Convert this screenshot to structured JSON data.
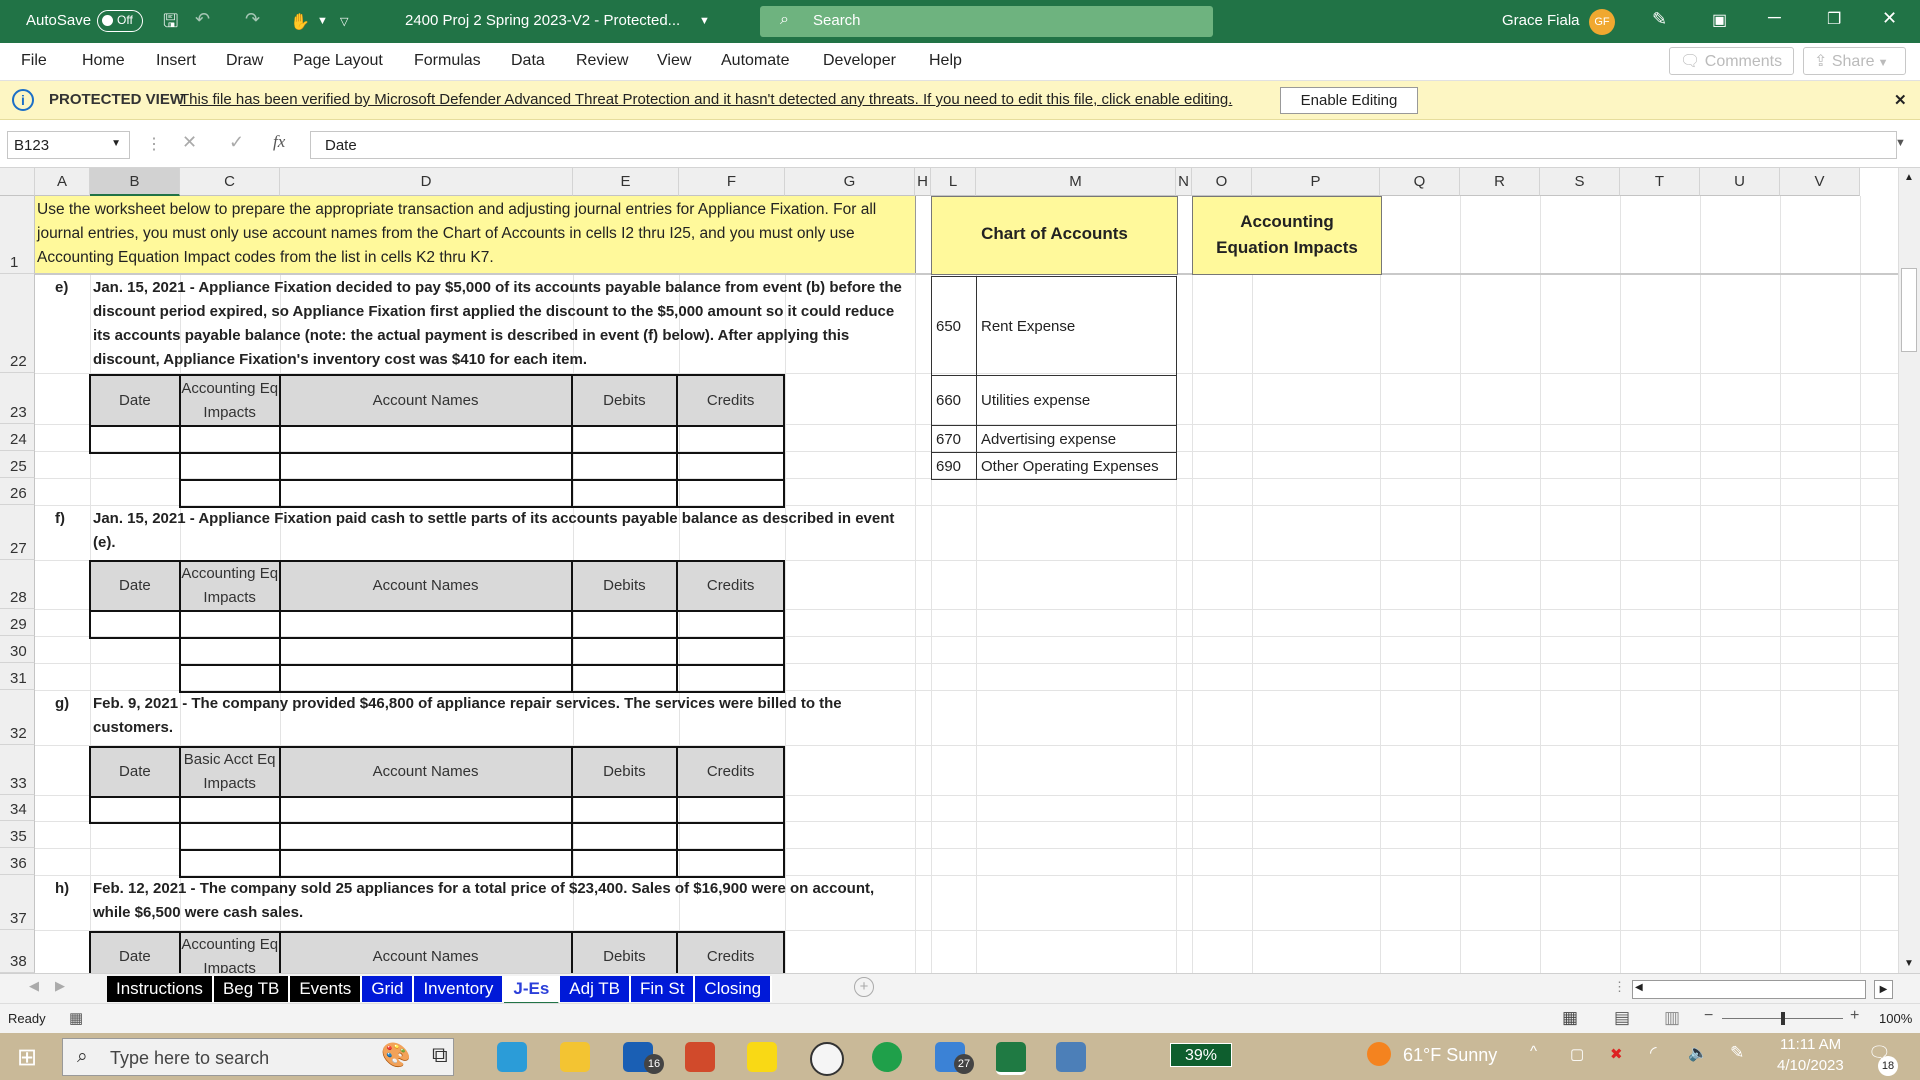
{
  "titlebar": {
    "autosave": "AutoSave",
    "autosave_state": "Off",
    "document_title": "2400 Proj 2 Spring 2023-V2  -  Protected...",
    "search_placeholder": "Search",
    "user_name": "Grace Fiala",
    "user_initials": "GF"
  },
  "menu": {
    "items": [
      "File",
      "Home",
      "Insert",
      "Draw",
      "Page Layout",
      "Formulas",
      "Data",
      "Review",
      "View",
      "Automate",
      "Developer",
      "Help"
    ],
    "comments": "Comments",
    "share": "Share"
  },
  "protected_view": {
    "label": "PROTECTED VIEW",
    "message": "This file has been verified by Microsoft Defender Advanced Threat Protection and it hasn't detected any threats. If you need to edit this file, click enable editing.",
    "enable_button": "Enable Editing"
  },
  "formula_bar": {
    "name_box": "B123",
    "fx": "fx",
    "value": "Date"
  },
  "columns": [
    "A",
    "B",
    "C",
    "D",
    "E",
    "F",
    "G",
    "H",
    "L",
    "M",
    "N",
    "O",
    "P",
    "Q",
    "R",
    "S",
    "T",
    "U",
    "V"
  ],
  "rows": [
    "1",
    "22",
    "23",
    "24",
    "25",
    "26",
    "27",
    "28",
    "29",
    "30",
    "31",
    "32",
    "33",
    "34",
    "35",
    "36",
    "37",
    "38"
  ],
  "instructions": "Use the worksheet below to prepare the appropriate transaction and adjusting journal entries for Appliance Fixation. For all journal entries, you must only use account names from the Chart of Accounts in cells I2 thru I25, and you must only use Accounting Equation Impact codes from the list in cells K2 thru K7.",
  "chart_of_accounts_header": "Chart of Accounts",
  "accounting_equation_header": "Accounting Equation Impacts",
  "coa": [
    {
      "code": "650",
      "name": "Rent Expense"
    },
    {
      "code": "660",
      "name": "Utilities expense"
    },
    {
      "code": "670",
      "name": "Advertising expense"
    },
    {
      "code": "690",
      "name": "Other Operating Expenses"
    }
  ],
  "events": [
    {
      "letter": "e)",
      "text": "Jan. 15, 2021 - Appliance Fixation decided to pay $5,000 of its accounts payable balance from event (b) before the discount period expired, so Appliance Fixation first applied the discount to the $5,000 amount so it could reduce its accounts payable balance (note: the actual payment is described in event (f) below). After applying this discount, Appliance Fixation's inventory cost was $410 for each item.",
      "table_headers": [
        "Date",
        "Accounting Eq Impacts",
        "Account Names",
        "Debits",
        "Credits"
      ]
    },
    {
      "letter": "f)",
      "text": "Jan. 15, 2021 - Appliance Fixation paid cash to settle parts of its accounts payable balance as described in event (e).",
      "table_headers": [
        "Date",
        "Accounting Eq Impacts",
        "Account Names",
        "Debits",
        "Credits"
      ]
    },
    {
      "letter": "g)",
      "text": "Feb. 9, 2021 - The company provided $46,800 of appliance repair services. The services were billed to the customers.",
      "table_headers": [
        "Date",
        "Basic Acct Eq Impacts",
        "Account Names",
        "Debits",
        "Credits"
      ]
    },
    {
      "letter": "h)",
      "text": "Feb. 12, 2021 - The company sold 25 appliances for a total price of $23,400. Sales of $16,900 were on account, while $6,500 were cash sales.",
      "table_headers": [
        "Date",
        "Accounting Eq Impacts",
        "Account Names",
        "Debits",
        "Credits"
      ]
    }
  ],
  "sheet_tabs": [
    "Instructions",
    "Beg TB",
    "Events",
    "Grid",
    "Inventory",
    "J-Es",
    "Adj TB",
    "Fin St",
    "Closing"
  ],
  "active_tab": "J-Es",
  "status": {
    "ready": "Ready",
    "zoom": "100%"
  },
  "taskbar": {
    "search_placeholder": "Type here to search",
    "mail_badge": "16",
    "badge_27": "27",
    "battery": "39%",
    "weather": "61°F  Sunny",
    "time": "11:11 AM",
    "date": "4/10/2023",
    "notifications": "18"
  },
  "colors": {
    "excel_green": "#217346",
    "instruction_fill": "#fff99b",
    "protected_fill": "#fdf6c3",
    "tab_blue": "#0019d8"
  }
}
